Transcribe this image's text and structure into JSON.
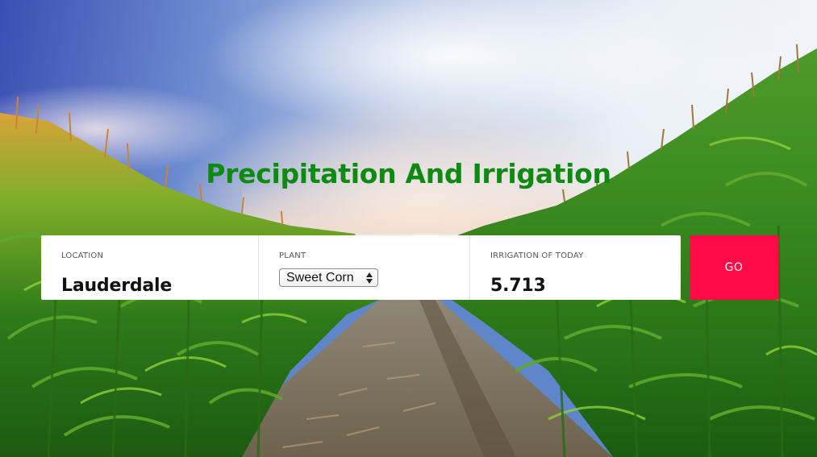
{
  "header": {
    "title": "Precipitation And Irrigation"
  },
  "form": {
    "location": {
      "label": "LOCATION",
      "value": "Lauderdale"
    },
    "plant": {
      "label": "PLANT",
      "selected": "Sweet Corn"
    },
    "irrigation": {
      "label": "IRRIGATION OF TODAY",
      "value": "5.713"
    },
    "go_label": "GO"
  },
  "colors": {
    "title": "#0c8a12",
    "go_button": "#ff0a45",
    "panel": "#ffffff"
  },
  "background": {
    "description_icon": "cornfield-photo"
  }
}
